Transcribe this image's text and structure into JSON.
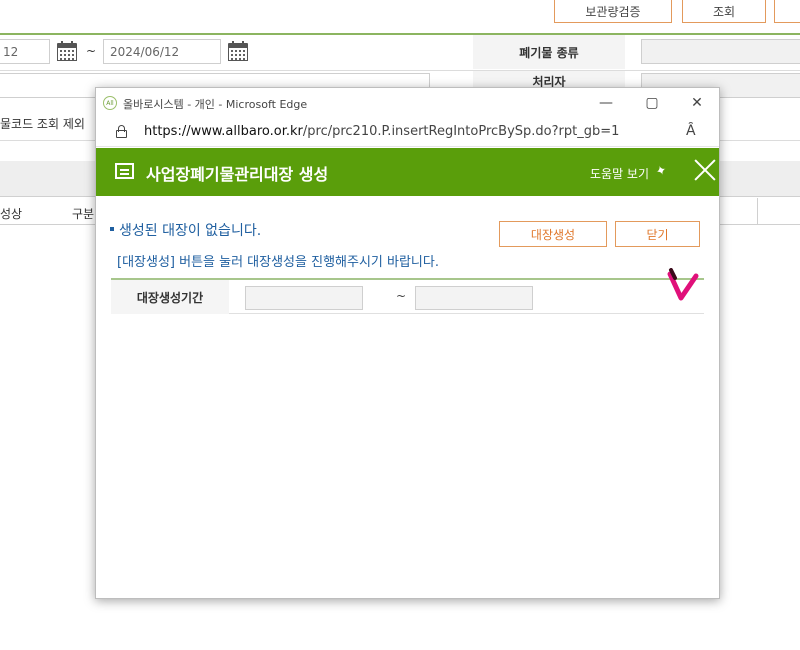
{
  "background": {
    "top_buttons": [
      "보관량검증",
      "조회"
    ],
    "date_partial": "12",
    "date_value": "2024/06/12",
    "date_sep": "~",
    "waste_type_label": "폐기물 종류",
    "handler_label": "처리자",
    "barcode_exclude_label": "물코드 조회 제외",
    "col_headers": [
      "성상",
      "구분"
    ]
  },
  "window": {
    "title": "올바로시스템 - 개인 - Microsoft Edge",
    "app_icon_text": "All",
    "url_host": "https://www.allbaro.or.kr",
    "url_path": "/prc/prc210.P.insertRegIntoPrcBySp.do?rpt_gb=1",
    "controls": [
      "—",
      "▢",
      "✕"
    ],
    "read_aloud_icon": "Ȃ"
  },
  "popup": {
    "title": "사업장폐기물관리대장 생성",
    "help_label": "도움말 보기",
    "message_main": "생성된 대장이 없습니다.",
    "message_sub": "[대장생성] 버튼을 눌러 대장생성을 진행해주시기 바랍니다.",
    "create_button": "대장생성",
    "close_button": "닫기",
    "period_label": "대장생성기간",
    "period_sep": "~",
    "period_from": "",
    "period_to": ""
  },
  "colors": {
    "header_green": "#5a9e0b",
    "button_orange": "#e39a5c",
    "message_blue": "#1f5fa0",
    "annotation_pink": "#e0107a"
  },
  "icons": [
    "calendar-icon",
    "doc-icon",
    "pin-icon",
    "lock-icon",
    "read-aloud-icon",
    "close-icon",
    "minimize-icon",
    "maximize-icon"
  ]
}
